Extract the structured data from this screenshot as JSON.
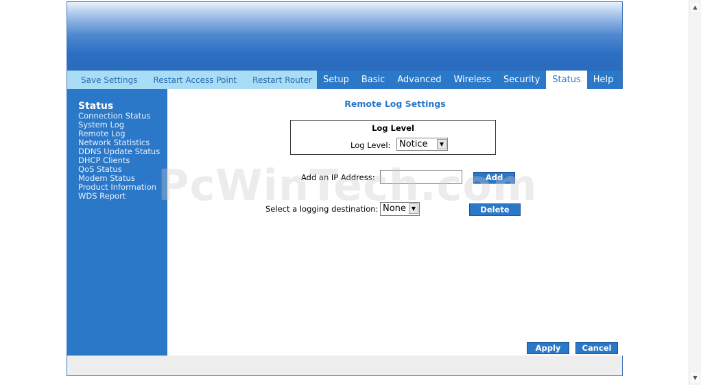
{
  "utility_links": [
    "Save Settings",
    "Restart Access Point",
    "Restart Router"
  ],
  "tabs": [
    {
      "label": "Setup",
      "active": false
    },
    {
      "label": "Basic",
      "active": false
    },
    {
      "label": "Advanced",
      "active": false
    },
    {
      "label": "Wireless",
      "active": false
    },
    {
      "label": "Security",
      "active": false
    },
    {
      "label": "Status",
      "active": true
    },
    {
      "label": "Help",
      "active": false
    }
  ],
  "sidebar": {
    "title": "Status",
    "items": [
      "Connection Status",
      "System Log",
      "Remote Log",
      "Network Statistics",
      "DDNS Update Status",
      "DHCP Clients",
      "QoS Status",
      "Modem Status",
      "Product Information",
      "WDS Report"
    ]
  },
  "main": {
    "title": "Remote Log Settings",
    "log_level_box": {
      "heading": "Log Level",
      "label": "Log Level:",
      "selected": "Notice"
    },
    "ip": {
      "label": "Add an IP Address:",
      "value": "",
      "add_label": "Add"
    },
    "destination": {
      "label": "Select a logging destination:",
      "selected": "None",
      "delete_label": "Delete"
    },
    "apply_label": "Apply",
    "cancel_label": "Cancel"
  },
  "watermark": "PcWinTech.com",
  "colors": {
    "brand_blue": "#2b78c8",
    "utility_bg": "#a8ddf5"
  }
}
